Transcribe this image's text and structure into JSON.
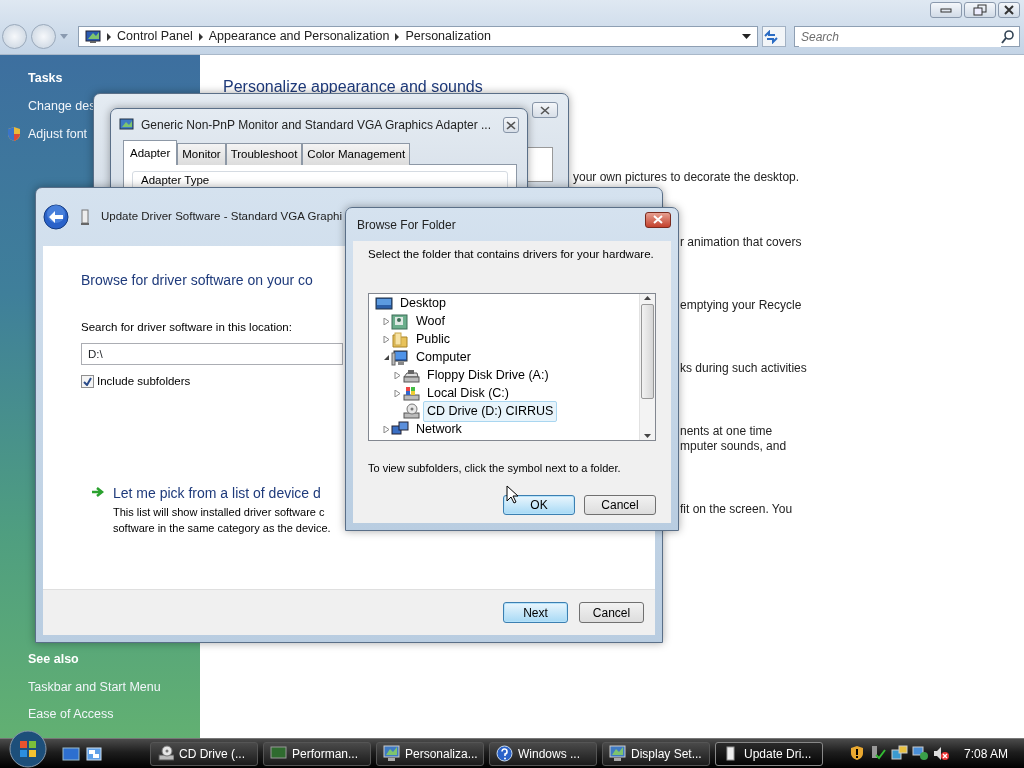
{
  "explorer": {
    "address": [
      "Control Panel",
      "Appearance and Personalization",
      "Personalization"
    ],
    "search": {
      "placeholder": "Search"
    },
    "sidebar": {
      "tasks_heading": "Tasks",
      "tasks": [
        {
          "label": "Change des",
          "kind": "plain"
        },
        {
          "label": "Adjust font",
          "kind": "shield"
        }
      ],
      "see_also_heading": "See also",
      "see_also": [
        "Taskbar and Start Menu",
        "Ease of Access"
      ]
    },
    "heading": "Personalize appearance and sounds",
    "fragments": [
      {
        "lines": [
          "your own pictures to decorate the desktop."
        ],
        "beside_dialog": false
      },
      {
        "lines": [
          "r animation that covers"
        ],
        "beside_dialog": true
      },
      {
        "lines": [
          "emptying your Recycle"
        ],
        "beside_dialog": true
      },
      {
        "lines": [
          "ks during such activities"
        ],
        "beside_dialog": true
      },
      {
        "lines": [
          "nents at one time",
          "mputer sounds, and"
        ],
        "beside_dialog": true
      },
      {
        "lines": [
          "fit on the screen. You"
        ],
        "beside_dialog": true
      }
    ]
  },
  "adapter_window": {
    "title": "Generic Non-PnP Monitor and Standard VGA Graphics Adapter ...",
    "tabs": [
      {
        "label": "Adapter",
        "selected": true
      },
      {
        "label": "Monitor",
        "selected": false
      },
      {
        "label": "Troubleshoot",
        "selected": false
      },
      {
        "label": "Color Management",
        "selected": false
      }
    ],
    "group_label": "Adapter Type"
  },
  "update_window": {
    "title": "Update Driver Software - Standard VGA Graphi",
    "heading": "Browse for driver software on your co",
    "location_label": "Search for driver software in this location:",
    "location_value": "D:\\",
    "include_subfolders": {
      "label": "Include subfolders",
      "checked": true
    },
    "pick_option": {
      "title": "Let me pick from a list of device d",
      "lines": [
        "This list will show installed driver software c",
        "software in the same category as the device."
      ]
    },
    "buttons": [
      {
        "label": "Next",
        "default": true
      },
      {
        "label": "Cancel",
        "default": false
      }
    ]
  },
  "browse_dialog": {
    "title": "Browse For Folder",
    "instruction": "Select the folder that contains drivers for your hardware.",
    "tree": [
      {
        "label": "Desktop",
        "kind": "desktop",
        "selected": false,
        "children": [
          {
            "label": "Woof",
            "kind": "user",
            "selected": false,
            "expanded": false
          },
          {
            "label": "Public",
            "kind": "folder",
            "selected": false,
            "expanded": false
          },
          {
            "label": "Computer",
            "kind": "computer",
            "selected": false,
            "expanded": true,
            "children": [
              {
                "label": "Floppy Disk Drive (A:)",
                "kind": "floppy",
                "selected": false,
                "expanded": false
              },
              {
                "label": "Local Disk (C:)",
                "kind": "disk",
                "selected": false,
                "expanded": false
              },
              {
                "label": "CD Drive (D:) CIRRUS",
                "kind": "cd",
                "selected": true
              }
            ]
          },
          {
            "label": "Network",
            "kind": "network",
            "selected": false,
            "expanded": false
          }
        ]
      }
    ],
    "hint": "To view subfolders, click the symbol next to a folder.",
    "buttons": [
      {
        "label": "OK",
        "default": true
      },
      {
        "label": "Cancel",
        "default": false
      }
    ]
  },
  "taskbar": {
    "tasks": [
      {
        "label": "CD Drive (...",
        "kind": "cd",
        "active": false
      },
      {
        "label": "Performan...",
        "kind": "monitor",
        "active": false
      },
      {
        "label": "Personaliza...",
        "kind": "display",
        "active": false
      },
      {
        "label": "Windows ...",
        "kind": "help",
        "active": false
      },
      {
        "label": "Display Set...",
        "kind": "display",
        "active": false
      },
      {
        "label": "Update Dri...",
        "kind": "device",
        "active": true
      }
    ],
    "clock": "7:08 AM"
  }
}
